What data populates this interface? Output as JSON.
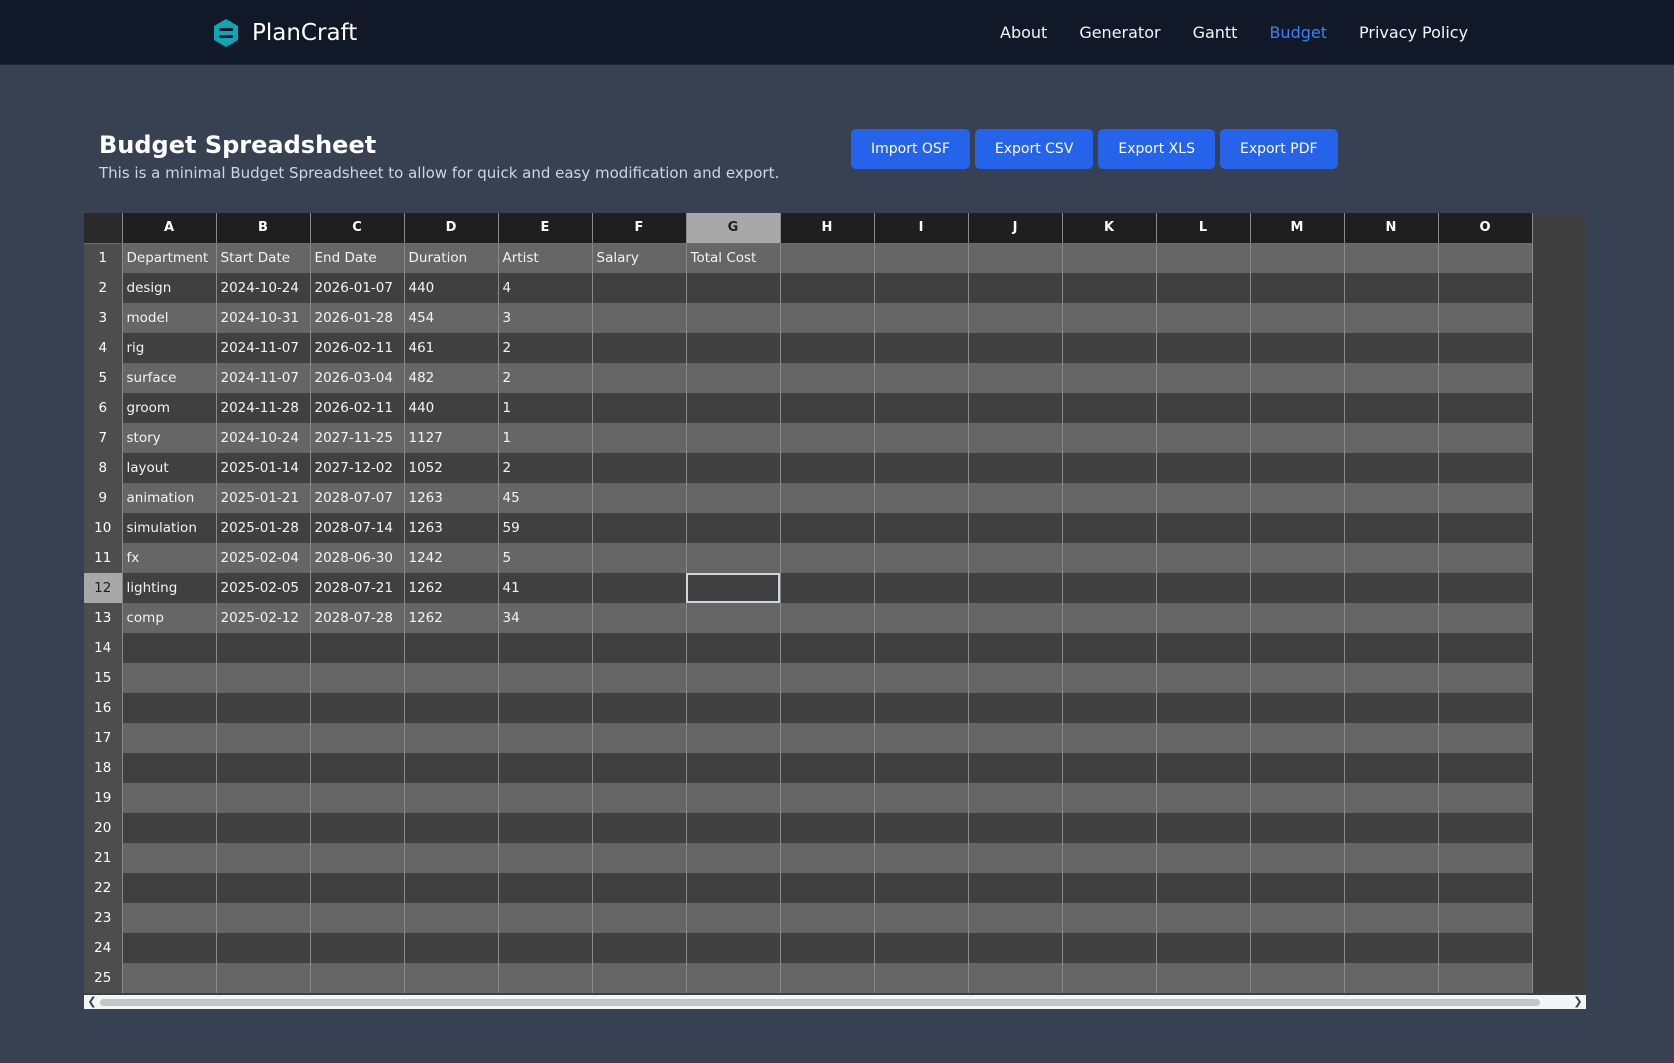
{
  "app": {
    "name": "PlanCraft",
    "logo_icon": "hexagon-logo-icon",
    "accent": "#3b82f6",
    "nav_bg": "#111827"
  },
  "nav": {
    "links": [
      {
        "label": "About",
        "active": false
      },
      {
        "label": "Generator",
        "active": false
      },
      {
        "label": "Gantt",
        "active": false
      },
      {
        "label": "Budget",
        "active": true
      },
      {
        "label": "Privacy Policy",
        "active": false
      }
    ]
  },
  "header": {
    "title": "Budget Spreadsheet",
    "subtitle": "This is a minimal Budget Spreadsheet to allow for quick and easy modification and export."
  },
  "toolbar": {
    "import_osf": "Import OSF",
    "export_csv": "Export CSV",
    "export_xls": "Export XLS",
    "export_pdf": "Export PDF",
    "button_color": "#2563eb"
  },
  "sheet": {
    "columns": [
      "A",
      "B",
      "C",
      "D",
      "E",
      "F",
      "G",
      "H",
      "I",
      "J",
      "K",
      "L",
      "M",
      "N",
      "O"
    ],
    "selected_column": "G",
    "selected_row": 12,
    "row_count": 25,
    "rows": [
      [
        "Department",
        "Start Date",
        "End Date",
        "Duration",
        "Artist",
        "Salary",
        "Total Cost"
      ],
      [
        "design",
        "2024-10-24",
        "2026-01-07",
        "440",
        "4"
      ],
      [
        "model",
        "2024-10-31",
        "2026-01-28",
        "454",
        "3"
      ],
      [
        "rig",
        "2024-11-07",
        "2026-02-11",
        "461",
        "2"
      ],
      [
        "surface",
        "2024-11-07",
        "2026-03-04",
        "482",
        "2"
      ],
      [
        "groom",
        "2024-11-28",
        "2026-02-11",
        "440",
        "1"
      ],
      [
        "story",
        "2024-10-24",
        "2027-11-25",
        "1127",
        "1"
      ],
      [
        "layout",
        "2025-01-14",
        "2027-12-02",
        "1052",
        "2"
      ],
      [
        "animation",
        "2025-01-21",
        "2028-07-07",
        "1263",
        "45"
      ],
      [
        "simulation",
        "2025-01-28",
        "2028-07-14",
        "1263",
        "59"
      ],
      [
        "fx",
        "2025-02-04",
        "2028-06-30",
        "1242",
        "5"
      ],
      [
        "lighting",
        "2025-02-05",
        "2028-07-21",
        "1262",
        "41"
      ],
      [
        "comp",
        "2025-02-12",
        "2028-07-28",
        "1262",
        "34"
      ]
    ]
  },
  "scrollbar": {
    "left_icon": "chevron-left-icon",
    "right_icon": "chevron-right-icon"
  }
}
